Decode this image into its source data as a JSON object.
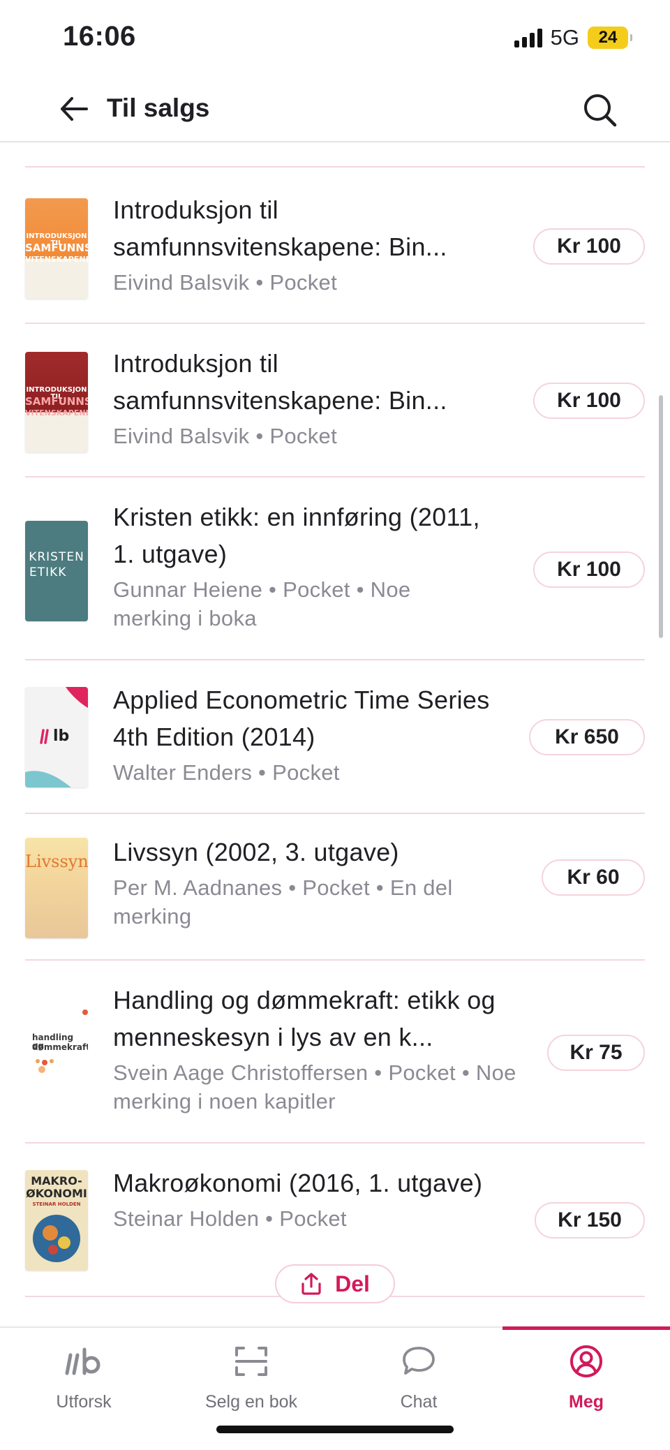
{
  "status_bar": {
    "time": "16:06",
    "network": "5G",
    "battery": "24"
  },
  "header": {
    "title": "Til salgs"
  },
  "listings": [
    {
      "title": "Introduksjon til samfunnsvitenskapene: Bin...",
      "meta": "Eivind Balsvik • Pocket",
      "price": "Kr 100",
      "cover": "orange"
    },
    {
      "title": "Introduksjon til samfunnsvitenskapene: Bin...",
      "meta": "Eivind Balsvik • Pocket",
      "price": "Kr 100",
      "cover": "red"
    },
    {
      "title": "Kristen etikk: en innføring (2011, 1. utgave)",
      "meta": "Gunnar Heiene • Pocket • Noe merking i boka",
      "price": "Kr 100",
      "cover": "teal"
    },
    {
      "title": "Applied Econometric Time Series 4th Edition (2014)",
      "meta": "Walter Enders • Pocket",
      "price": "Kr 650",
      "cover": "placeholder"
    },
    {
      "title": "Livssyn (2002, 3. utgave)",
      "meta": "Per M. Aadnanes • Pocket • En del merking",
      "price": "Kr 60",
      "cover": "yellow"
    },
    {
      "title": "Handling og dømmekraft: etikk og menneskesyn i lys av en k...",
      "meta": "Svein Aage Christoffersen • Pocket • Noe merking i noen kapitler",
      "price": "Kr 75",
      "cover": "white"
    },
    {
      "title": "Makroøkonomi (2016, 1. utgave)",
      "meta": "Steinar Holden • Pocket",
      "price": "Kr 150",
      "cover": "makro"
    }
  ],
  "covers": {
    "book1": [
      "INTRODUKSJON TIL",
      "SAMFUNNS-",
      "VITENSKAPENE"
    ],
    "book3": [
      "KRISTEN",
      "ETIKK"
    ],
    "book4": "lb",
    "book5": "Livssyn",
    "book6": [
      "handling og",
      "dømmekraft"
    ],
    "book7": [
      "MAKRO-",
      "ØKONOMI",
      "STEINAR HOLDEN"
    ]
  },
  "share": {
    "label": "Del"
  },
  "tabs": [
    {
      "label": "Utforsk",
      "icon": "ilb-logo-icon"
    },
    {
      "label": "Selg en bok",
      "icon": "scan-icon"
    },
    {
      "label": "Chat",
      "icon": "chat-bubble-icon"
    },
    {
      "label": "Meg",
      "icon": "profile-icon",
      "active": true
    }
  ],
  "colors": {
    "accent": "#d21a5a",
    "divider": "#f4d7de",
    "muted_text": "#8a8a93"
  }
}
